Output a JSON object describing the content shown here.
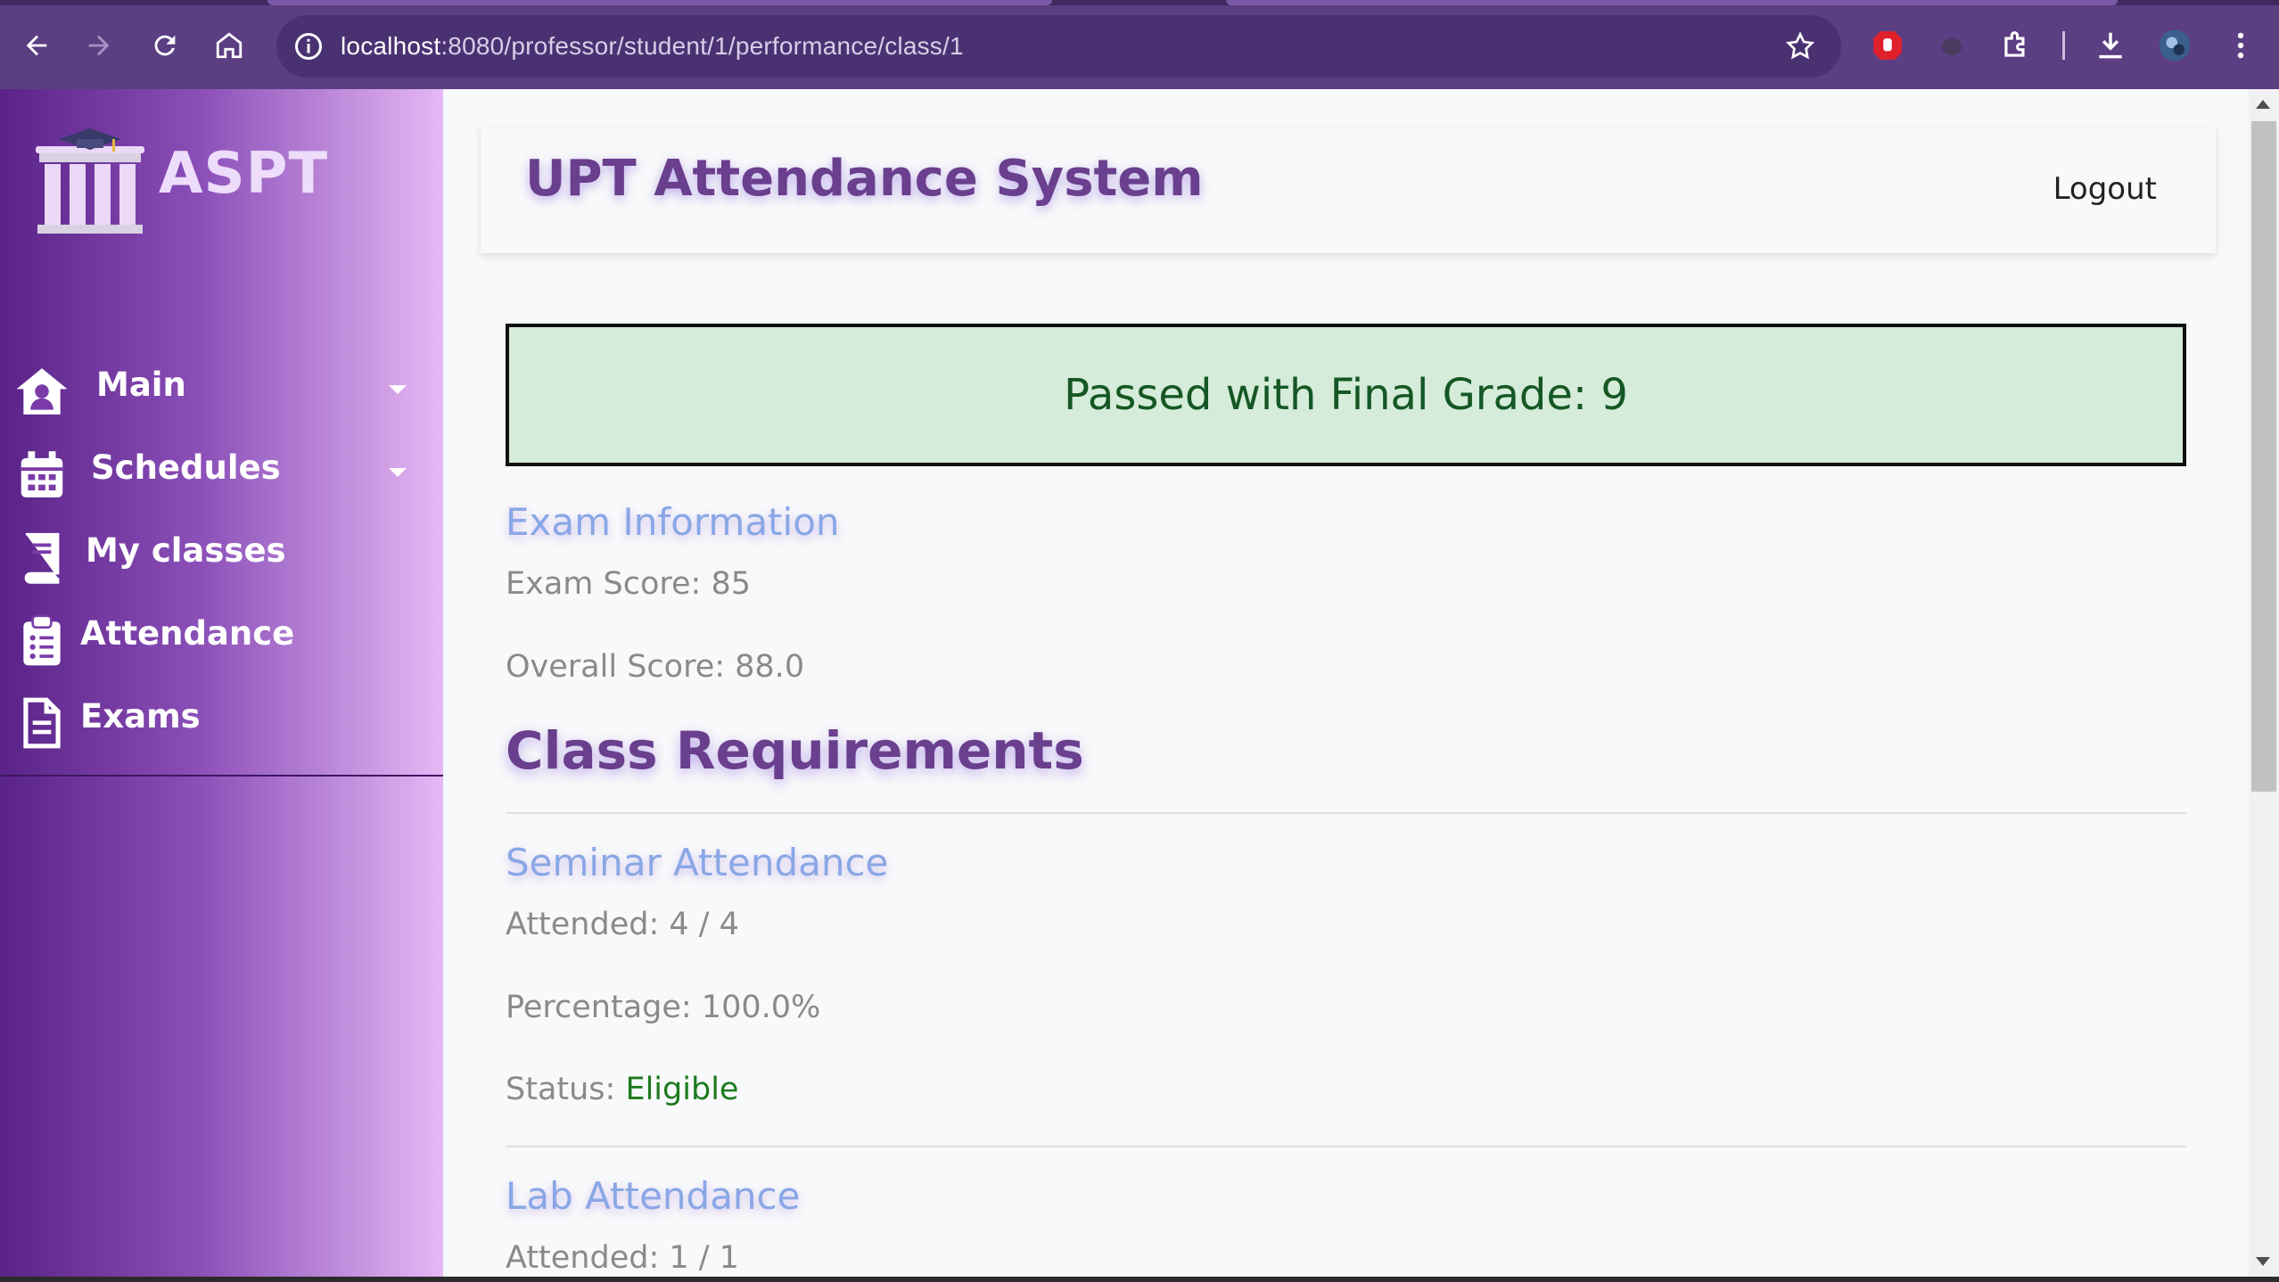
{
  "browser": {
    "url_host": "localhost",
    "url_path": ":8080/professor/student/1/performance/class/1"
  },
  "sidebar": {
    "brand": "ASPT",
    "items": [
      {
        "label": "Main",
        "icon": "home-user-icon",
        "has_dropdown": true
      },
      {
        "label": "Schedules",
        "icon": "calendar-icon",
        "has_dropdown": true
      },
      {
        "label": "My classes",
        "icon": "book-icon",
        "has_dropdown": false
      },
      {
        "label": "Attendance",
        "icon": "clipboard-list-icon",
        "has_dropdown": false
      },
      {
        "label": "Exams",
        "icon": "document-icon",
        "has_dropdown": false
      }
    ]
  },
  "header": {
    "title": "UPT Attendance System",
    "logout_label": "Logout"
  },
  "result": {
    "banner": "Passed with Final Grade: 9"
  },
  "exam": {
    "heading": "Exam Information",
    "score": "Exam Score: 85",
    "overall": "Overall Score: 88.0"
  },
  "requirements": {
    "heading": "Class Requirements",
    "seminar": {
      "heading": "Seminar Attendance",
      "attended": "Attended: 4 / 4",
      "percentage": "Percentage: 100.0%",
      "status_label": "Status:",
      "status_value": "Eligible"
    },
    "lab": {
      "heading": "Lab Attendance",
      "attended": "Attended: 1 / 1"
    }
  },
  "colors": {
    "brand_purple": "#6a3f8e",
    "sidebar_start": "#5a2288",
    "sidebar_end": "#e6b8f5",
    "success_bg": "#d4ecd9",
    "success_text": "#155724",
    "section_heading": "#8aa7e6",
    "eligible": "#1d7a1d"
  }
}
